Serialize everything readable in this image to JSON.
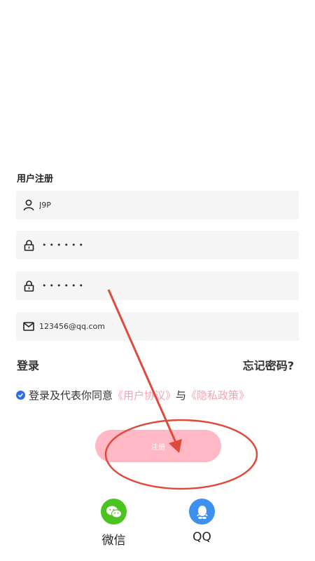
{
  "form": {
    "title": "用户注册",
    "username_value": "J9P",
    "password_mask": "••••••",
    "confirm_mask": "••••••",
    "email_value": "123456@qq.com"
  },
  "links": {
    "login": "登录",
    "forgot": "忘记密码?"
  },
  "agreement": {
    "prefix": "登录及代表你同意",
    "user_agreement": "《用户协议》",
    "conjunction": "与",
    "privacy_policy": "《隐私政策》",
    "checked": true
  },
  "register_button": {
    "label": "注册"
  },
  "social": {
    "wechat": {
      "label": "微信",
      "color": "#4cc41f",
      "icon": "wechat-icon"
    },
    "qq": {
      "label": "QQ",
      "color": "#3d8ff0",
      "icon": "qq-icon"
    }
  },
  "annotation": {
    "color": "#e04a3a"
  },
  "colors": {
    "accent": "#ffb8c4",
    "link": "#f4a3b4",
    "checkbox": "#2d6fe6"
  }
}
